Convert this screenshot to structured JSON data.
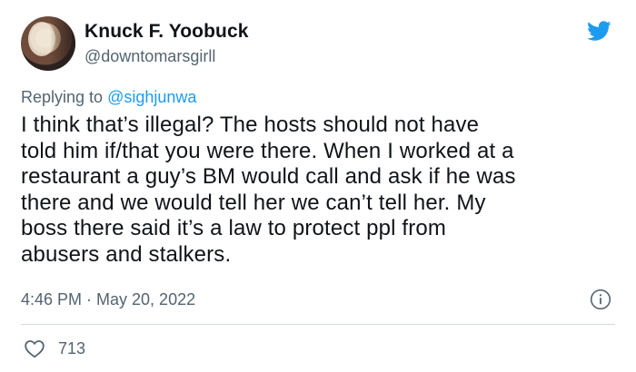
{
  "author": {
    "display_name": "Knuck F. Yoobuck",
    "handle": "@downtomarsgirll"
  },
  "reply": {
    "prefix": "Replying to ",
    "mention": "@sighjunwa"
  },
  "text": "I think that’s illegal? The hosts should not have\ntold him if/that you were there. When I worked at a\nrestaurant a guy’s BM would call and ask if he was\nthere and we would tell her we can’t tell her. My\nboss there said it’s a law to protect ppl from\nabusers and stalkers.",
  "timestamp": "4:46 PM · May 20, 2022",
  "likes": "713",
  "icons": {
    "brand": "twitter-bird-icon",
    "info": "info-icon",
    "like": "heart-icon"
  },
  "colors": {
    "brand": "#1d9bf0",
    "text": "#0f1419",
    "muted": "#536471",
    "divider": "#cfd9de"
  }
}
